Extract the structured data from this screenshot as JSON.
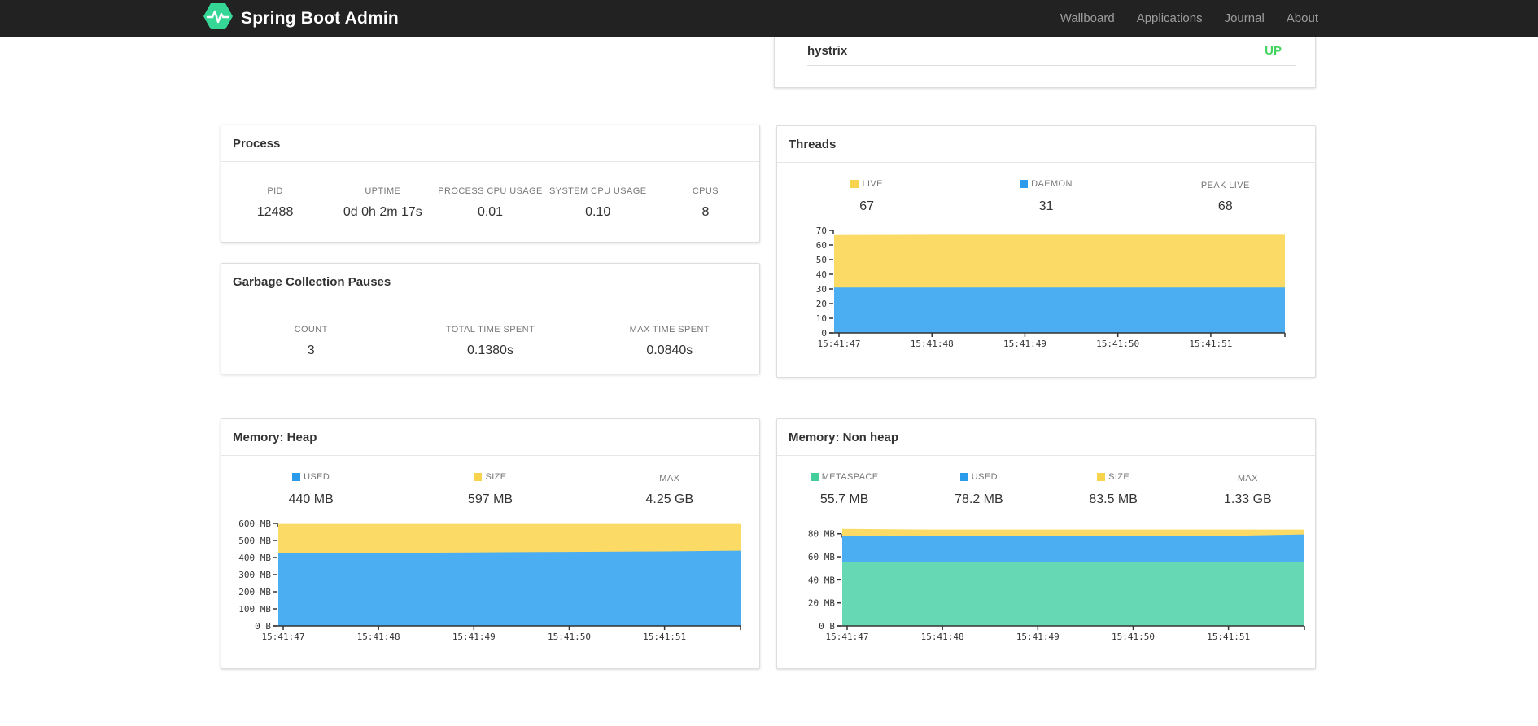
{
  "navbar": {
    "brand": "Spring Boot Admin",
    "items": [
      {
        "label": "Wallboard"
      },
      {
        "label": "Applications"
      },
      {
        "label": "Journal"
      },
      {
        "label": "About"
      }
    ]
  },
  "colors": {
    "navbar_bg": "#222222",
    "nav_link": "#9d9d9d",
    "brand_green": "#36d796",
    "status_up": "#42d35f",
    "area_blue": "#4badf2",
    "swatch_blue": "#2b9ceb",
    "area_yellow": "#fbdb66",
    "swatch_yellow": "#f8d44e",
    "area_green": "#66d9b4",
    "swatch_green": "#42cf9c"
  },
  "status_card": {
    "app_name": "hystrix",
    "status": "UP"
  },
  "cards": {
    "process": {
      "title": "Process",
      "stats": [
        {
          "label": "PID",
          "value": "12488"
        },
        {
          "label": "UPTIME",
          "value": "0d 0h 2m 17s"
        },
        {
          "label": "PROCESS CPU USAGE",
          "value": "0.01"
        },
        {
          "label": "SYSTEM CPU USAGE",
          "value": "0.10"
        },
        {
          "label": "CPUS",
          "value": "8"
        }
      ]
    },
    "gc": {
      "title": "Garbage Collection Pauses",
      "stats": [
        {
          "label": "COUNT",
          "value": "3"
        },
        {
          "label": "TOTAL TIME SPENT",
          "value": "0.1380s"
        },
        {
          "label": "MAX TIME SPENT",
          "value": "0.0840s"
        }
      ]
    },
    "threads": {
      "title": "Threads",
      "stats": [
        {
          "label": "LIVE",
          "value": "67",
          "swatch": "#f8d44e"
        },
        {
          "label": "DAEMON",
          "value": "31",
          "swatch": "#2b9ceb"
        },
        {
          "label": "PEAK LIVE",
          "value": "68"
        }
      ]
    },
    "heap": {
      "title": "Memory: Heap",
      "stats": [
        {
          "label": "USED",
          "value": "440 MB",
          "swatch": "#2b9ceb"
        },
        {
          "label": "SIZE",
          "value": "597 MB",
          "swatch": "#f8d44e"
        },
        {
          "label": "MAX",
          "value": "4.25 GB"
        }
      ]
    },
    "nonheap": {
      "title": "Memory: Non heap",
      "stats": [
        {
          "label": "METASPACE",
          "value": "55.7 MB",
          "swatch": "#42cf9c"
        },
        {
          "label": "USED",
          "value": "78.2 MB",
          "swatch": "#2b9ceb"
        },
        {
          "label": "SIZE",
          "value": "83.5 MB",
          "swatch": "#f8d44e"
        },
        {
          "label": "MAX",
          "value": "1.33 GB"
        }
      ]
    }
  },
  "chart_data": [
    {
      "id": "threads",
      "type": "area",
      "stacked": true,
      "title": "Threads",
      "x": [
        0,
        1,
        2,
        3,
        4,
        4.78
      ],
      "x_span": 4.78,
      "x_tick_labels": [
        "15:41:47",
        "15:41:48",
        "15:41:49",
        "15:41:50",
        "15:41:51"
      ],
      "ylim": [
        0,
        70
      ],
      "y_ticks": [
        {
          "v": 0,
          "label": "0"
        },
        {
          "v": 10,
          "label": "10"
        },
        {
          "v": 20,
          "label": "20"
        },
        {
          "v": 30,
          "label": "30"
        },
        {
          "v": 40,
          "label": "40"
        },
        {
          "v": 50,
          "label": "50"
        },
        {
          "v": 60,
          "label": "60"
        },
        {
          "v": 70,
          "label": "70"
        }
      ],
      "series": [
        {
          "name": "LIVE",
          "color": "#fbdb66",
          "values": [
            66.8,
            67,
            67,
            67,
            67,
            67
          ]
        },
        {
          "name": "DAEMON",
          "color": "#4badf2",
          "values": [
            31,
            31,
            31,
            31,
            31,
            31
          ]
        }
      ]
    },
    {
      "id": "heap",
      "type": "area",
      "stacked": true,
      "title": "Memory: Heap",
      "x": [
        0,
        1,
        2,
        3,
        4,
        4.78
      ],
      "x_span": 4.78,
      "x_tick_labels": [
        "15:41:47",
        "15:41:48",
        "15:41:49",
        "15:41:50",
        "15:41:51"
      ],
      "ylim": [
        0,
        600
      ],
      "y_unit": "MB",
      "y_ticks": [
        {
          "v": 0,
          "label": "0 B"
        },
        {
          "v": 100,
          "label": "100 MB"
        },
        {
          "v": 200,
          "label": "200 MB"
        },
        {
          "v": 300,
          "label": "300 MB"
        },
        {
          "v": 400,
          "label": "400 MB"
        },
        {
          "v": 500,
          "label": "500 MB"
        },
        {
          "v": 600,
          "label": "600 MB"
        }
      ],
      "series": [
        {
          "name": "SIZE",
          "color": "#fbdb66",
          "values": [
            597,
            597,
            597,
            597,
            597,
            597
          ]
        },
        {
          "name": "USED",
          "color": "#4badf2",
          "values": [
            424,
            427,
            430,
            433,
            436,
            440
          ]
        }
      ]
    },
    {
      "id": "nonheap",
      "type": "area",
      "stacked": true,
      "title": "Memory: Non heap",
      "x": [
        0,
        1,
        2,
        3,
        4,
        4.78
      ],
      "x_span": 4.78,
      "x_tick_labels": [
        "15:41:47",
        "15:41:48",
        "15:41:49",
        "15:41:50",
        "15:41:51"
      ],
      "ylim": [
        0,
        89
      ],
      "y_unit": "MB",
      "y_ticks": [
        {
          "v": 0,
          "label": "0 B"
        },
        {
          "v": 20,
          "label": "20 MB"
        },
        {
          "v": 40,
          "label": "40 MB"
        },
        {
          "v": 60,
          "label": "60 MB"
        },
        {
          "v": 80,
          "label": "80 MB"
        }
      ],
      "series": [
        {
          "name": "SIZE",
          "color": "#fbdb66",
          "values": [
            84.2,
            83.6,
            83.6,
            83.6,
            83.6,
            83.6
          ]
        },
        {
          "name": "USED",
          "color": "#4badf2",
          "values": [
            77.9,
            77.9,
            78,
            78,
            78.1,
            79.4
          ]
        },
        {
          "name": "METASPACE",
          "color": "#66d9b4",
          "values": [
            55.6,
            55.6,
            55.7,
            55.7,
            55.7,
            55.9
          ]
        }
      ]
    }
  ]
}
